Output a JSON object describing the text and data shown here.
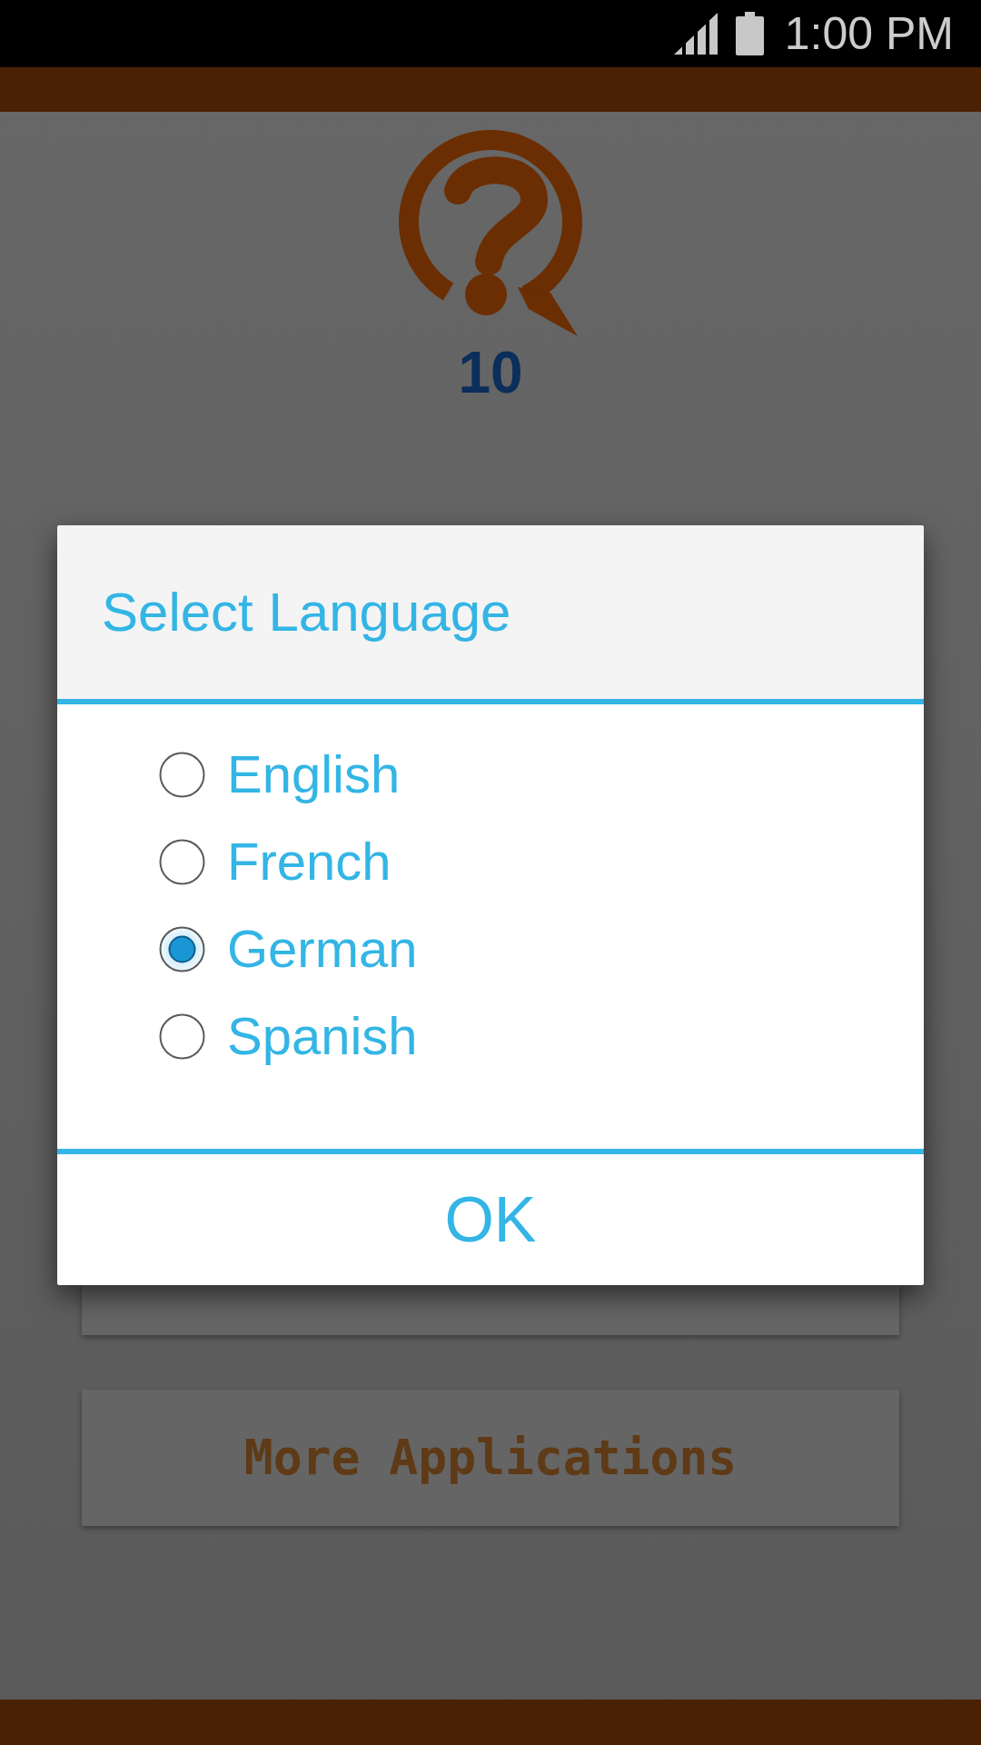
{
  "status_bar": {
    "time": "1:00 PM"
  },
  "header": {
    "score": "10"
  },
  "dialog": {
    "title": "Select Language",
    "options": [
      {
        "label": "English",
        "selected": false
      },
      {
        "label": "French",
        "selected": false
      },
      {
        "label": "German",
        "selected": true
      },
      {
        "label": "Spanish",
        "selected": false
      }
    ],
    "buttons": [
      "OK"
    ]
  },
  "menu_buttons": [
    {
      "label": "More Applications"
    }
  ]
}
